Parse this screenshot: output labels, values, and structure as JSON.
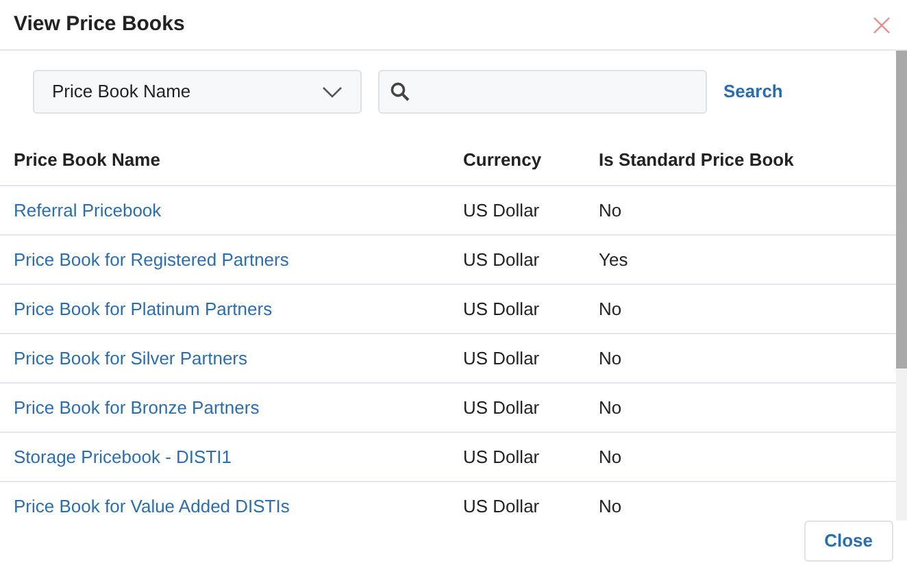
{
  "dialog": {
    "title": "View Price Books"
  },
  "filter": {
    "field": "Price Book Name",
    "search_button": "Search"
  },
  "table": {
    "columns": [
      "Price Book Name",
      "Currency",
      "Is Standard Price Book"
    ],
    "rows": [
      {
        "name": "Referral Pricebook",
        "currency": "US Dollar",
        "is_standard": "No"
      },
      {
        "name": "Price Book for Registered Partners",
        "currency": "US Dollar",
        "is_standard": "Yes"
      },
      {
        "name": "Price Book for Platinum Partners",
        "currency": "US Dollar",
        "is_standard": "No"
      },
      {
        "name": "Price Book for Silver Partners",
        "currency": "US Dollar",
        "is_standard": "No"
      },
      {
        "name": "Price Book for Bronze Partners",
        "currency": "US Dollar",
        "is_standard": "No"
      },
      {
        "name": "Storage Pricebook - DISTI1",
        "currency": "US Dollar",
        "is_standard": "No"
      },
      {
        "name": "Price Book for Value Added DISTIs",
        "currency": "US Dollar",
        "is_standard": "No"
      }
    ]
  },
  "footer": {
    "close_button": "Close"
  }
}
